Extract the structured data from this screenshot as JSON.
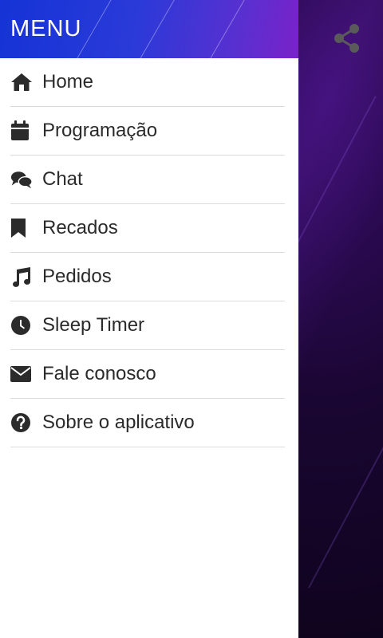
{
  "drawer": {
    "title": "MENU",
    "items": [
      {
        "label": "Home",
        "icon": "home-icon"
      },
      {
        "label": "Programação",
        "icon": "calendar-icon"
      },
      {
        "label": "Chat",
        "icon": "chat-icon"
      },
      {
        "label": "Recados",
        "icon": "bookmark-icon"
      },
      {
        "label": "Pedidos",
        "icon": "music-note-icon"
      },
      {
        "label": "Sleep Timer",
        "icon": "clock-icon"
      },
      {
        "label": "Fale conosco",
        "icon": "envelope-icon"
      },
      {
        "label": "Sobre o aplicativo",
        "icon": "question-circle-icon"
      }
    ]
  },
  "topbar": {
    "share_icon": "share-icon"
  },
  "colors": {
    "header_start": "#1533d6",
    "header_end": "#7a22c8",
    "text": "#2b2b2b",
    "backdrop": "#0e0520"
  }
}
